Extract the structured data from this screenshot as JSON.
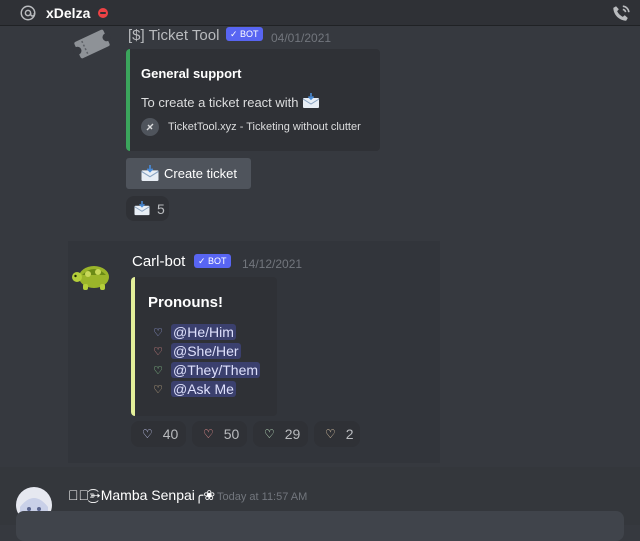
{
  "header": {
    "channel_name": "xDelza",
    "status": "do-not-disturb",
    "call_icon": "phone-call-icon",
    "at_icon": "at-sign-icon"
  },
  "ticket_message": {
    "author": "[$] Ticket Tool",
    "bot_tag": "✓ BOT",
    "timestamp": "04/01/2021",
    "embed": {
      "accent": "#3ba55c",
      "title": "General support",
      "description": "To create a ticket react with",
      "footer": "TicketTool.xyz - Ticketing without clutter"
    },
    "button_label": "Create ticket",
    "reaction_count": "5"
  },
  "carl_message": {
    "author": "Carl-bot",
    "bot_tag": "✓ BOT",
    "timestamp": "14/12/2021",
    "embed": {
      "accent": "#e4f09a",
      "title": "Pronouns!",
      "items": [
        {
          "heart": "♡",
          "color": "#a8b4ff",
          "label": "@He/Him"
        },
        {
          "heart": "♡",
          "color": "#ff9a9a",
          "label": "@She/Her"
        },
        {
          "heart": "♡",
          "color": "#9ae6a0",
          "label": "@They/Them"
        },
        {
          "heart": "♡",
          "color": "#e6c79a",
          "label": "@Ask Me"
        }
      ]
    },
    "reactions": [
      {
        "heart": "♡",
        "color": "#cfd3ff",
        "count": "40"
      },
      {
        "heart": "♡",
        "color": "#ff9a9a",
        "count": "50"
      },
      {
        "heart": "♡",
        "color": "#c9f0cc",
        "count": "29"
      },
      {
        "heart": "♡",
        "color": "#f0d7b4",
        "count": "2"
      }
    ]
  },
  "last_message": {
    "author": "ঔৣ͜͡➳Mamba Senpai╭❀",
    "timestamp": "Today at 11:57 AM"
  }
}
